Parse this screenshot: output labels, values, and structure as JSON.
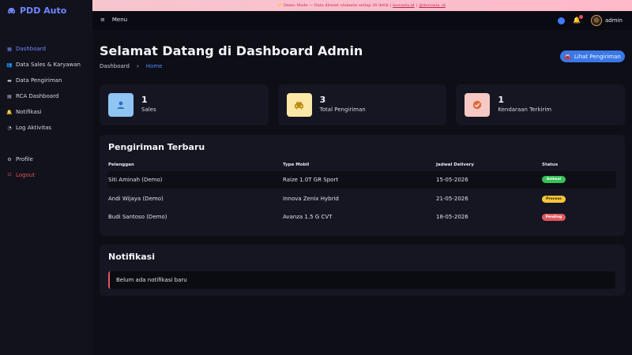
{
  "app": {
    "title": "PDD Auto"
  },
  "sidebar": {
    "items": [
      {
        "label": "Dashboard",
        "icon": "grid-icon",
        "active": true
      },
      {
        "label": "Data Sales & Karyawan",
        "icon": "users-icon"
      },
      {
        "label": "Data Pengiriman",
        "icon": "truck-icon"
      },
      {
        "label": "RCA Dashboard",
        "icon": "document-icon"
      },
      {
        "label": "Notifikasi",
        "icon": "bell-icon"
      },
      {
        "label": "Log Aktivitas",
        "icon": "history-icon"
      }
    ],
    "bottom": [
      {
        "label": "Profile",
        "icon": "user-cog-icon"
      },
      {
        "label": "Logout",
        "icon": "power-icon"
      }
    ]
  },
  "banner": {
    "prefix": "⚡ Demo Mode — Data direset otomatis setiap 30 detik |",
    "link1": "inovasta.id",
    "sep": "|",
    "link2": "@inovasta_id"
  },
  "topbar": {
    "menu_label": "Menu",
    "user_name": "admin"
  },
  "header": {
    "title": "Selamat Datang di Dashboard Admin",
    "breadcrumb": [
      "Dashboard",
      "Home"
    ],
    "action_label": "Lihat Pengiriman"
  },
  "stats": [
    {
      "value": "1",
      "label": "Sales",
      "icon": "user-icon",
      "bg": "#8fc4f3",
      "fg": "#2f6fb8"
    },
    {
      "value": "3",
      "label": "Total Pengiriman",
      "icon": "car-icon",
      "bg": "#fbe7a6",
      "fg": "#b88b10"
    },
    {
      "value": "1",
      "label": "Kendaraan Terkirim",
      "icon": "check-circle-icon",
      "bg": "#f6c9c4",
      "fg": "#e06a3b"
    }
  ],
  "deliveries": {
    "title": "Pengiriman Terbaru",
    "columns": [
      "Pelanggan",
      "Type Mobil",
      "Jadwal Delivery",
      "Status"
    ],
    "rows": [
      {
        "customer": "Siti Aminah (Demo)",
        "car": "Raize 1.0T GR Sport",
        "date": "15-05-2026",
        "status": "Selesai",
        "status_color": "#36c35a"
      },
      {
        "customer": "Andi Wijaya (Demo)",
        "car": "Innova Zenix Hybrid",
        "date": "21-05-2026",
        "status": "Process",
        "status_color": "#f6c53b"
      },
      {
        "customer": "Budi Santoso (Demo)",
        "car": "Avanza 1.5 G CVT",
        "date": "18-05-2026",
        "status": "Pending",
        "status_color": "#e3575f"
      }
    ]
  },
  "notifications": {
    "title": "Notifikasi",
    "empty_text": "Belum ada notifikasi baru"
  }
}
